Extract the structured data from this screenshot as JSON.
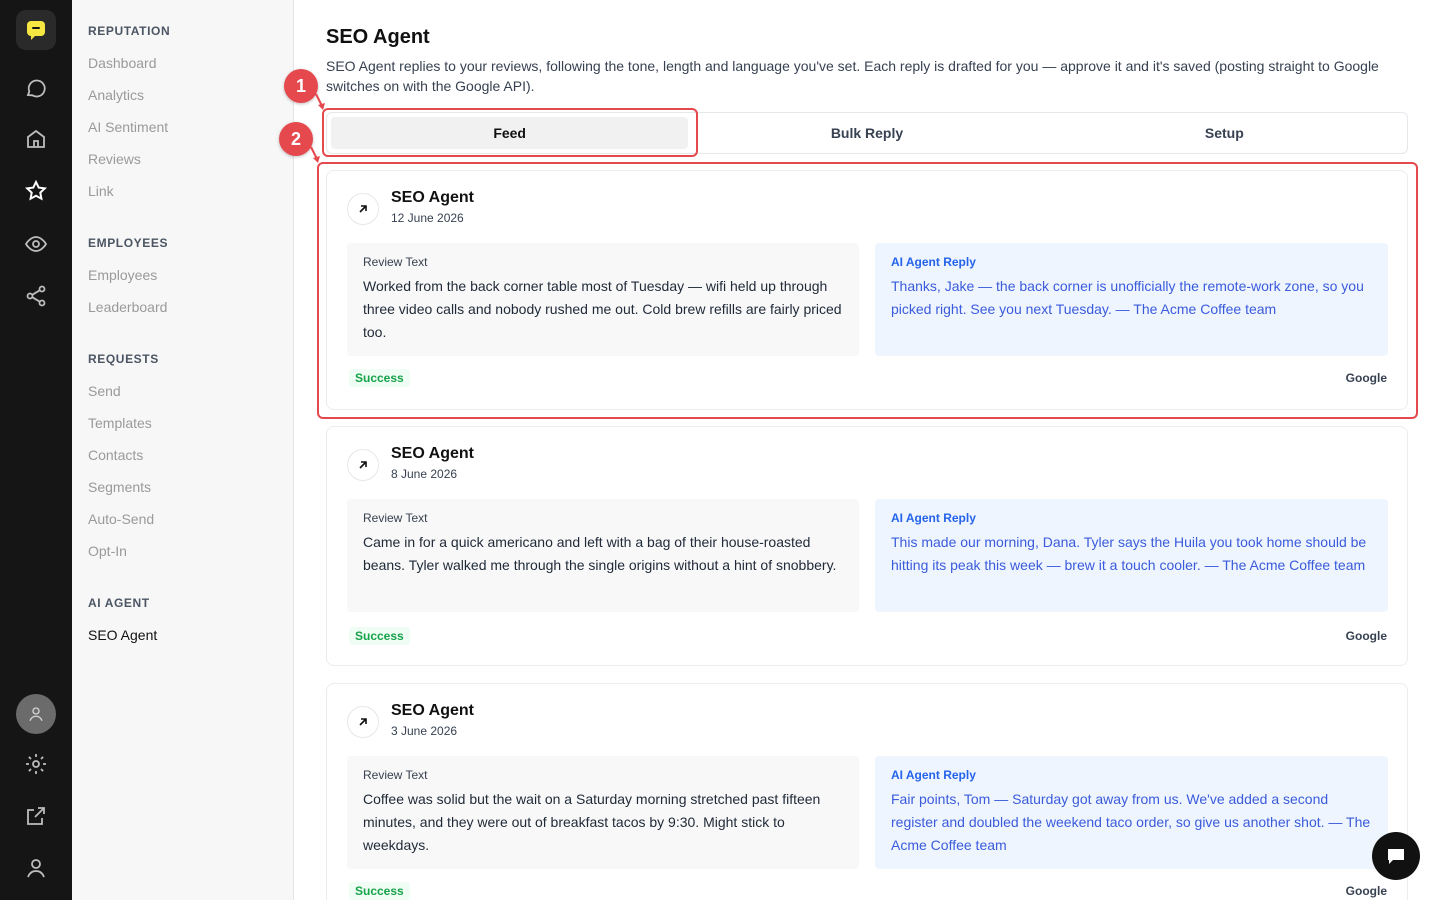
{
  "rail": {
    "icons": [
      "logo-icon",
      "chat-icon",
      "home-icon",
      "star-icon",
      "eye-icon",
      "share-icon",
      "avatar-icon",
      "settings-icon",
      "external-link-icon",
      "user-icon"
    ]
  },
  "sidebar": {
    "sections": [
      {
        "title": "REPUTATION",
        "items": [
          "Dashboard",
          "Analytics",
          "AI Sentiment",
          "Reviews",
          "Link"
        ]
      },
      {
        "title": "EMPLOYEES",
        "items": [
          "Employees",
          "Leaderboard"
        ]
      },
      {
        "title": "REQUESTS",
        "items": [
          "Send",
          "Templates",
          "Contacts",
          "Segments",
          "Auto-Send",
          "Opt-In"
        ]
      },
      {
        "title": "AI AGENT",
        "items": [
          "SEO Agent"
        ]
      }
    ],
    "active": "SEO Agent"
  },
  "page": {
    "title": "SEO Agent",
    "description": "SEO Agent replies to your reviews, following the tone, length and language you've set. Each reply is drafted for you — approve it and it's saved (posting straight to Google switches on with the Google API)."
  },
  "tabs": [
    {
      "label": "Feed",
      "active": true
    },
    {
      "label": "Bulk Reply",
      "active": false
    },
    {
      "label": "Setup",
      "active": false
    }
  ],
  "feed": [
    {
      "name": "SEO Agent",
      "date": "12 June 2026",
      "review_label": "Review Text",
      "review": "Worked from the back corner table most of Tuesday — wifi held up through three video calls and nobody rushed me out. Cold brew refills are fairly priced too.",
      "reply_label": "AI Agent Reply",
      "reply": "Thanks, Jake — the back corner is unofficially the remote-work zone, so you picked right. See you next Tuesday. — The Acme Coffee team",
      "status": "Success",
      "source": "Google"
    },
    {
      "name": "SEO Agent",
      "date": "8 June 2026",
      "review_label": "Review Text",
      "review": "Came in for a quick americano and left with a bag of their house-roasted beans. Tyler walked me through the single origins without a hint of snobbery.",
      "reply_label": "AI Agent Reply",
      "reply": "This made our morning, Dana. Tyler says the Huila you took home should be hitting its peak this week — brew it a touch cooler. — The Acme Coffee team",
      "status": "Success",
      "source": "Google"
    },
    {
      "name": "SEO Agent",
      "date": "3 June 2026",
      "review_label": "Review Text",
      "review": "Coffee was solid but the wait on a Saturday morning stretched past fifteen minutes, and they were out of breakfast tacos by 9:30. Might stick to weekdays.",
      "reply_label": "AI Agent Reply",
      "reply": "Fair points, Tom — Saturday got away from us. We've added a second register and doubled the weekend taco order, so give us another shot. — The Acme Coffee team",
      "status": "Success",
      "source": "Google"
    }
  ],
  "annotations": [
    "1",
    "2"
  ],
  "colors": {
    "rail_bg": "#151515",
    "brand_yellow": "#f5e642",
    "highlight_red": "#e5484d",
    "reply_blue": "#3b5bdb",
    "success_green": "#16a34a"
  }
}
